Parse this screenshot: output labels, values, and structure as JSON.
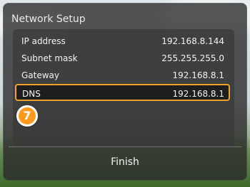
{
  "dialog": {
    "title": "Network Setup"
  },
  "settings": {
    "ip_address": {
      "label": "IP address",
      "value": "192.168.8.144"
    },
    "subnet_mask": {
      "label": "Subnet mask",
      "value": "255.255.255.0"
    },
    "gateway": {
      "label": "Gateway",
      "value": "192.168.8.1"
    },
    "dns": {
      "label": "DNS",
      "value": "192.168.8.1"
    }
  },
  "callout": {
    "step_number": "7"
  },
  "footer": {
    "finish_label": "Finish"
  },
  "colors": {
    "highlight": "#f0a22c",
    "badge": "#ff9a1f"
  }
}
